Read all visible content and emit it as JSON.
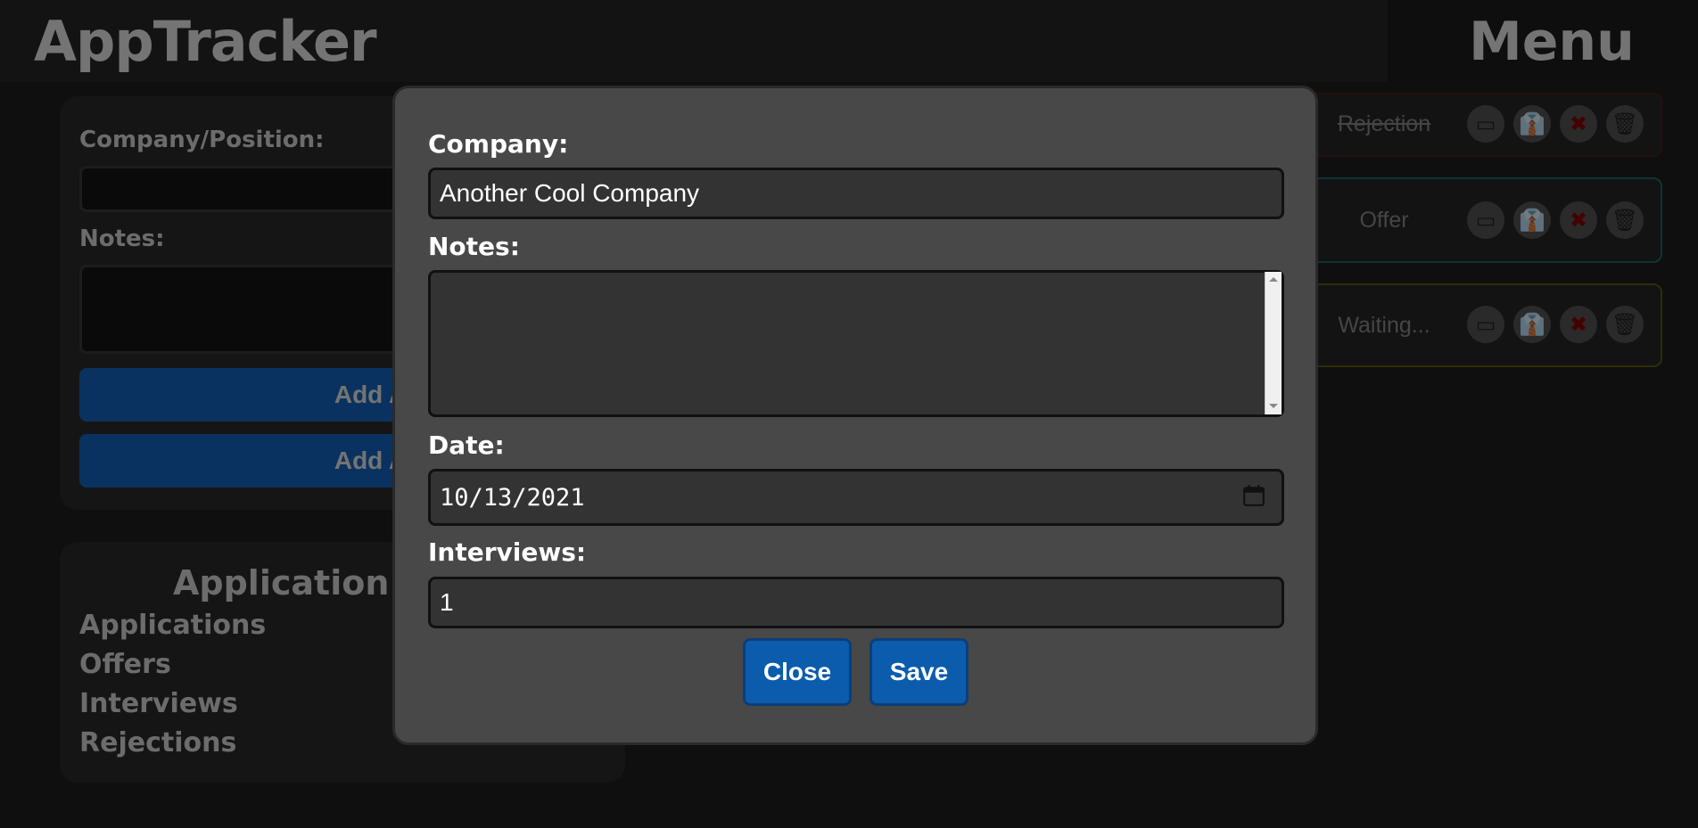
{
  "header": {
    "app_title": "AppTracker",
    "menu_label": "Menu"
  },
  "add_form": {
    "company_label": "Company/Position:",
    "notes_label": "Notes:",
    "add_application_button": "Add Applica",
    "add_advanced_button": "Add Advanc"
  },
  "stats": {
    "title": "Application St",
    "labels": [
      "Applications",
      "Offers",
      "Interviews",
      "Rejections"
    ]
  },
  "applications": [
    {
      "status": "Rejection",
      "status_color": "#8a2a2a"
    },
    {
      "status": "Offer",
      "status_color": "#1fa8a0"
    },
    {
      "status": "Waiting...",
      "status_color": "#8a8a1a"
    }
  ],
  "modal": {
    "company_label": "Company:",
    "company_value": "Another Cool Company",
    "notes_label": "Notes:",
    "notes_value": "",
    "date_label": "Date:",
    "date_value": "10/13/2021",
    "interviews_label": "Interviews:",
    "interviews_value": "1",
    "close_button": "Close",
    "save_button": "Save"
  },
  "colors": {
    "modal_bg": "#484848",
    "button_bg": "#0b5cad",
    "overlay": "rgba(0,0,0,0.5)"
  }
}
